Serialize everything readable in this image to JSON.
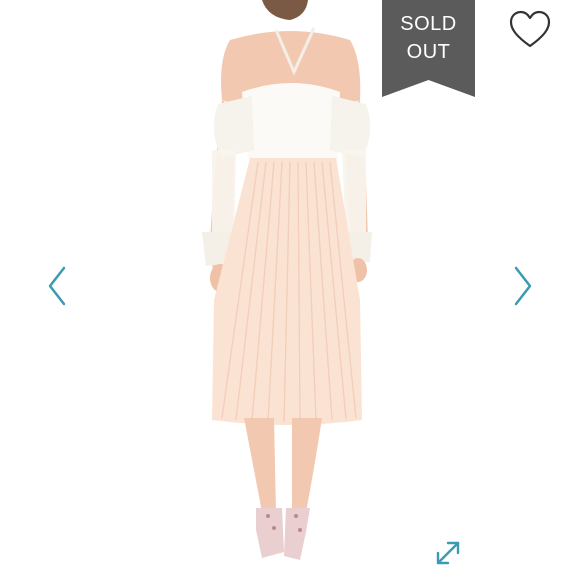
{
  "badge": {
    "line1": "SOLD",
    "line2": "OUT",
    "color": "#5b5b5b"
  },
  "icons": {
    "like": "heart-outline-icon",
    "prev": "chevron-left-icon",
    "next": "chevron-right-icon",
    "expand": "expand-arrows-icon"
  },
  "colors": {
    "accent": "#3a9bb3",
    "badge": "#5b5b5b",
    "heart": "#333333"
  }
}
